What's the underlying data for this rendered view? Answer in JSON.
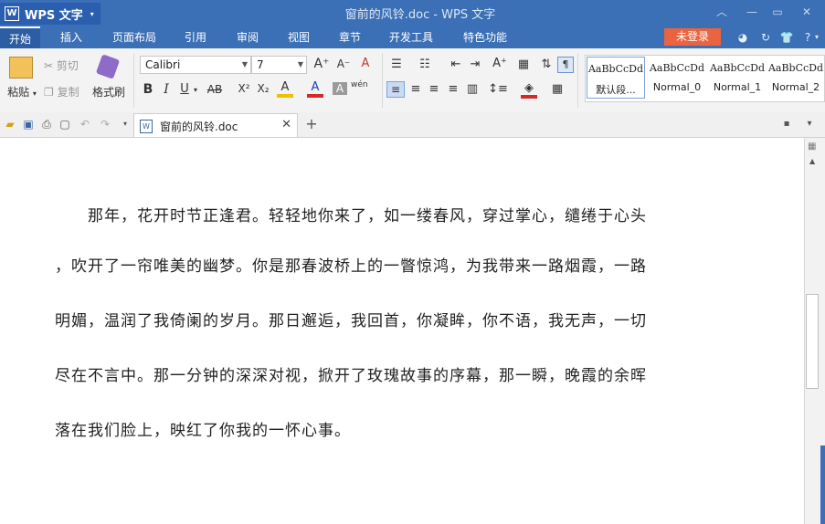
{
  "app": {
    "logo": "W",
    "name": "WPS 文字",
    "dropdown": "▾"
  },
  "window": {
    "title": "窗前的风铃.doc - WPS 文字",
    "buttons": [
      "︿",
      "—",
      "▭",
      "✕"
    ]
  },
  "tabs": [
    "开始",
    "插入",
    "页面布局",
    "引用",
    "审阅",
    "视图",
    "章节",
    "开发工具",
    "特色功能"
  ],
  "login": "未登录",
  "top_icons": [
    "skin-icon",
    "sync-icon",
    "shirt-icon",
    "help-icon"
  ],
  "top_icon_glyphs": [
    "◕",
    "↻",
    "👕",
    "?"
  ],
  "help_dropdown": "▾",
  "clipboard": {
    "paste": "粘贴",
    "cut": "剪切",
    "copy": "复制",
    "format_painter": "格式刷"
  },
  "font": {
    "name": "Calibri",
    "size": "7"
  },
  "format_buttons": [
    "B",
    "I",
    "U",
    "AB",
    "X²",
    "X₂",
    "A",
    "A",
    "A",
    "wén"
  ],
  "styles": [
    {
      "preview": "AaBbCcDd",
      "name": "默认段..."
    },
    {
      "preview": "AaBbCcDd",
      "name": "Normal_0"
    },
    {
      "preview": "AaBbCcDd",
      "name": "Normal_1"
    },
    {
      "preview": "AaBbCcDd",
      "name": "Normal_2"
    }
  ],
  "doc_tab": {
    "icon": "W",
    "name": "窗前的风铃.doc",
    "close": "✕",
    "new": "+"
  },
  "document": {
    "lines": [
      "　　那年，花开时节正逢君。轻轻地你来了，如一缕春风，穿过掌心，缱绻于心头",
      "，吹开了一帘唯美的幽梦。你是那春波桥上的一瞥惊鸿，为我带来一路烟霞，一路",
      "明媚，温润了我倚阑的岁月。那日邂逅，我回首，你凝眸，你不语，我无声，一切",
      "尽在不言中。那一分钟的深深对视，掀开了玫瑰故事的序幕，那一瞬，晚霞的余晖",
      "落在我们脸上，映红了你我的一怀心事。"
    ]
  }
}
